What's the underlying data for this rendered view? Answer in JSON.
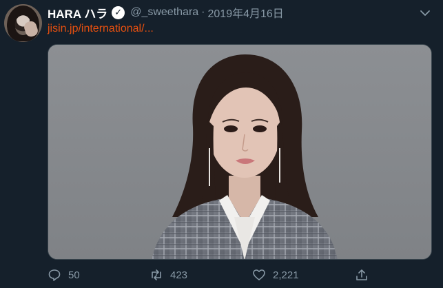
{
  "tweet": {
    "author_name": "HARA ハラ",
    "verified_icon": "verified-check-icon",
    "handle": "@_sweethara",
    "separator": "·",
    "date": "2019年4月16日",
    "link_text": "jisin.jp/international/..."
  },
  "actions": {
    "reply_count": "50",
    "retweet_count": "423",
    "like_count": "2,221"
  },
  "icons": [
    "avatar",
    "verified-check-icon",
    "chevron-down-icon",
    "reply-icon",
    "retweet-icon",
    "like-icon",
    "share-icon"
  ],
  "colors": {
    "background": "#15202b",
    "name": "#ffffff",
    "secondary": "#8899a6",
    "link": "#e8500f"
  }
}
